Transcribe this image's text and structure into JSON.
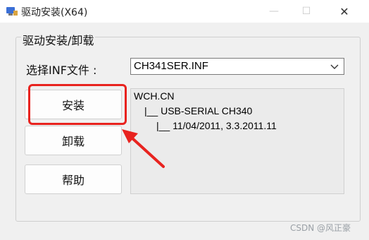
{
  "window": {
    "title": "驱动安装(X64)",
    "controls": {
      "minimize": "—",
      "maximize": "☐",
      "close": "✕"
    }
  },
  "group": {
    "title": "驱动安装/卸载"
  },
  "inf": {
    "label": "选择INF文件 :",
    "selected": "CH341SER.INF"
  },
  "buttons": {
    "install": "安装",
    "uninstall": "卸载",
    "help": "帮助"
  },
  "info": {
    "lines": [
      "WCH.CN",
      "|__ USB-SERIAL CH340",
      "|__ 11/04/2011, 3.3.2011.11"
    ]
  },
  "annotation": {
    "highlight_color": "#e8231f"
  },
  "watermark": {
    "text": "CSDN @风正豪"
  },
  "icons": {
    "app": "usb-driver-icon",
    "dropdown": "chevron-down-icon",
    "annotation_arrow": "red-arrow-icon"
  }
}
